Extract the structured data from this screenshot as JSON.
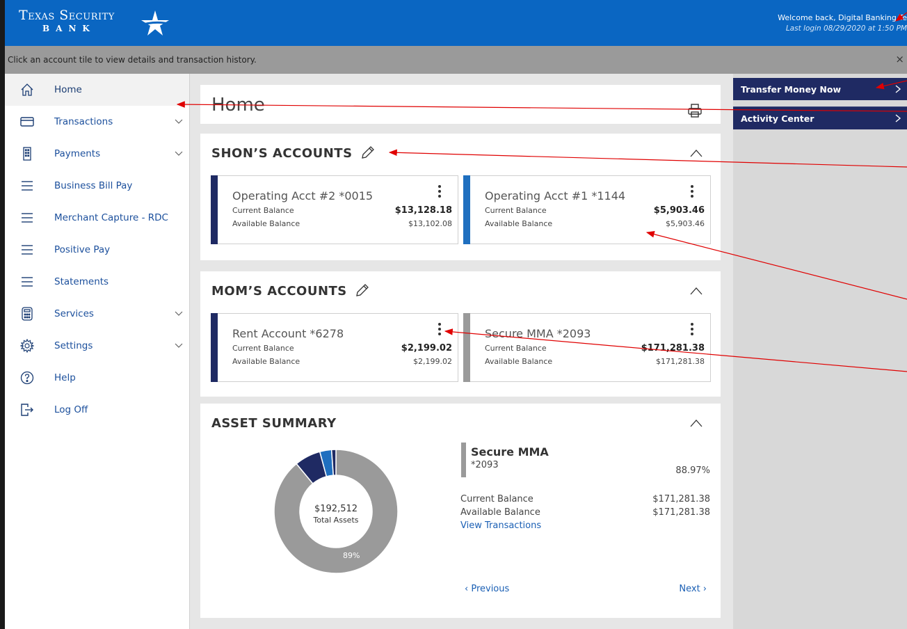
{
  "header": {
    "logo_line1": "Texas Security",
    "logo_line2": "BANK",
    "welcome": "Welcome back, Digital Banking Te",
    "last_login": "Last login 08/29/2020 at 1:50 PM"
  },
  "notice": {
    "text": "Click an account tile to view details and transaction history.",
    "close": "×"
  },
  "sidebar": {
    "items": [
      {
        "label": "Home",
        "icon": "home-icon",
        "active": true
      },
      {
        "label": "Transactions",
        "icon": "card-icon",
        "expandable": true
      },
      {
        "label": "Payments",
        "icon": "building-icon",
        "expandable": true
      },
      {
        "label": "Business Bill Pay",
        "icon": "menu-icon"
      },
      {
        "label": "Merchant Capture - RDC",
        "icon": "menu-icon"
      },
      {
        "label": "Positive Pay",
        "icon": "menu-icon"
      },
      {
        "label": "Statements",
        "icon": "menu-icon"
      },
      {
        "label": "Services",
        "icon": "calculator-icon",
        "expandable": true
      },
      {
        "label": "Settings",
        "icon": "gear-icon",
        "expandable": true
      },
      {
        "label": "Help",
        "icon": "help-icon"
      },
      {
        "label": "Log Off",
        "icon": "logout-icon"
      }
    ]
  },
  "main": {
    "title": "Home",
    "groups": [
      {
        "title": "SHON’S ACCOUNTS",
        "accounts": [
          {
            "name": "Operating Acct #2 *0015",
            "current_label": "Current Balance",
            "current": "$13,128.18",
            "available_label": "Available Balance",
            "available": "$13,102.08",
            "color": "#1f2a63"
          },
          {
            "name": "Operating Acct #1 *1144",
            "current_label": "Current Balance",
            "current": "$5,903.46",
            "available_label": "Available Balance",
            "available": "$5,903.46",
            "color": "#1f6fbf"
          }
        ]
      },
      {
        "title": "MOM’S ACCOUNTS",
        "accounts": [
          {
            "name": "Rent Account *6278",
            "current_label": "Current Balance",
            "current": "$2,199.02",
            "available_label": "Available Balance",
            "available": "$2,199.02",
            "color": "#1f2a63"
          },
          {
            "name": "Secure MMA *2093",
            "current_label": "Current Balance",
            "current": "$171,281.38",
            "available_label": "Available Balance",
            "available": "$171,281.38",
            "color": "#9a9a9a"
          }
        ]
      }
    ],
    "asset_summary": {
      "title": "ASSET SUMMARY",
      "total_value": "$192,512",
      "total_label": "Total Assets",
      "largest_pct_label": "89%",
      "detail": {
        "name": "Secure MMA",
        "number": "*2093",
        "percent": "88.97%",
        "current_label": "Current Balance",
        "current": "$171,281.38",
        "available_label": "Available Balance",
        "available": "$171,281.38",
        "link": "View Transactions"
      },
      "prev": "‹  Previous",
      "next": "Next  ›"
    }
  },
  "chart_data": {
    "type": "pie",
    "values": [
      171281.38,
      13128.18,
      5903.46,
      2199.02
    ],
    "colors": [
      "#9a9a9a",
      "#1f2a63",
      "#1f6fbf",
      "#1f2a63"
    ],
    "center_label": "$192,512 Total Assets"
  },
  "right_panel": {
    "links": [
      {
        "label": "Transfer Money Now"
      },
      {
        "label": "Activity Center"
      }
    ]
  },
  "colors": {
    "header": "#0a66c2",
    "navy": "#1f2a63",
    "annotation": "#e00000"
  }
}
